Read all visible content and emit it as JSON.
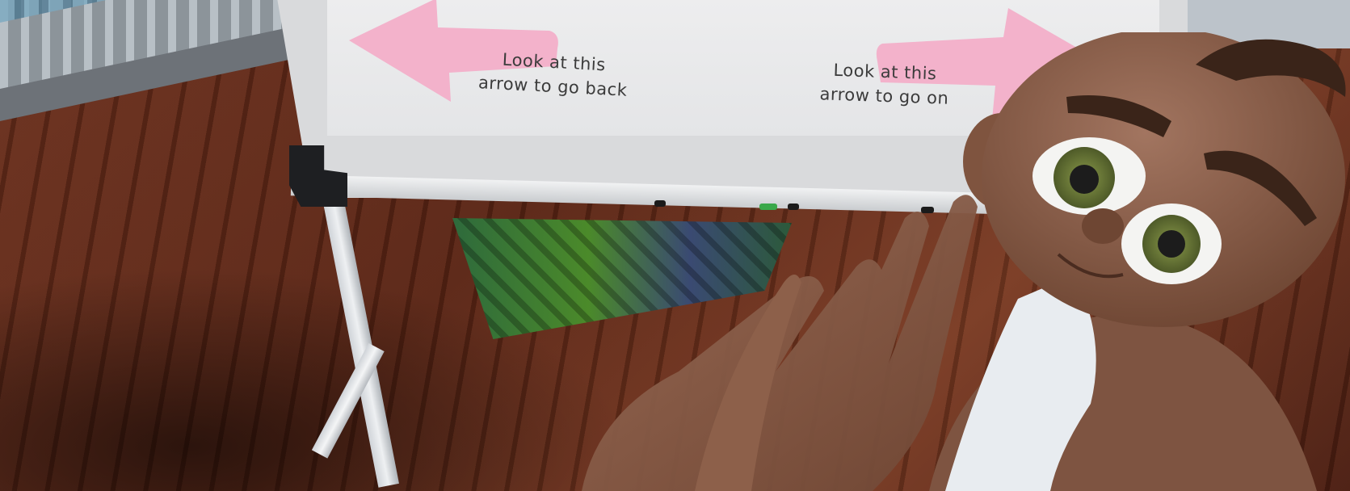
{
  "scene": {
    "whiteboard": {
      "back_arrow": {
        "caption": "Look at this arrow to go back",
        "line1": "Look at this",
        "line2": "arrow to go back"
      },
      "next_arrow": {
        "caption": "Look at this arrow to go on",
        "line1": "Look at this",
        "line2": "arrow to go on"
      },
      "arrow_color": "#f3b2cb",
      "board_color": "#e9eaeb"
    },
    "markers": [
      {
        "color": "#1b1b1b"
      },
      {
        "color": "#3aa84a"
      },
      {
        "color": "#1b1b1b"
      },
      {
        "color": "#1b1b1b"
      }
    ],
    "colors": {
      "floor": "#5e2817",
      "skin": "#8a5a42",
      "eye": "#6f7a3a"
    }
  }
}
